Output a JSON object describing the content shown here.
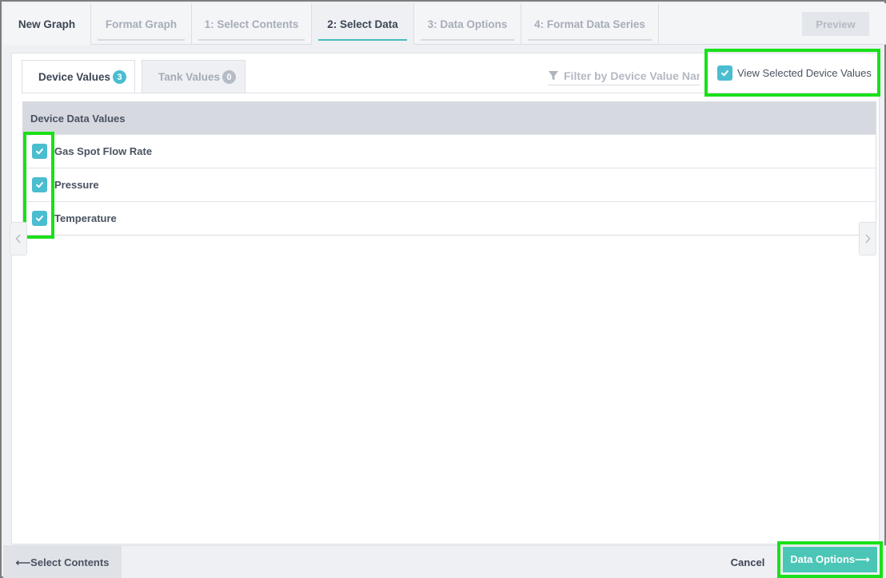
{
  "wizard": {
    "title": "New Graph",
    "tabs": [
      {
        "label": "Format Graph"
      },
      {
        "label": "1: Select Contents"
      },
      {
        "label": "2: Select Data"
      },
      {
        "label": "3: Data Options"
      },
      {
        "label": "4: Format Data Series"
      }
    ],
    "preview_label": "Preview"
  },
  "subtabs": [
    {
      "label": "Device Values",
      "count": "3"
    },
    {
      "label": "Tank Values",
      "count": "0"
    }
  ],
  "filter": {
    "placeholder": "Filter by Device Value Name",
    "icon": "funnel-icon"
  },
  "view_selected": {
    "label": "View Selected Device Values",
    "checked": true
  },
  "table": {
    "header": "Device Data Values",
    "rows": [
      {
        "label": "Gas Spot Flow Rate",
        "checked": true
      },
      {
        "label": "Pressure",
        "checked": true
      },
      {
        "label": "Temperature",
        "checked": true
      }
    ]
  },
  "footer": {
    "back_label": "⟵Select Contents",
    "cancel_label": "Cancel",
    "next_label": "Data Options⟶"
  },
  "colors": {
    "accent": "#4bbdd0",
    "next_button": "#4bc6b6",
    "highlight": "#19e019"
  }
}
